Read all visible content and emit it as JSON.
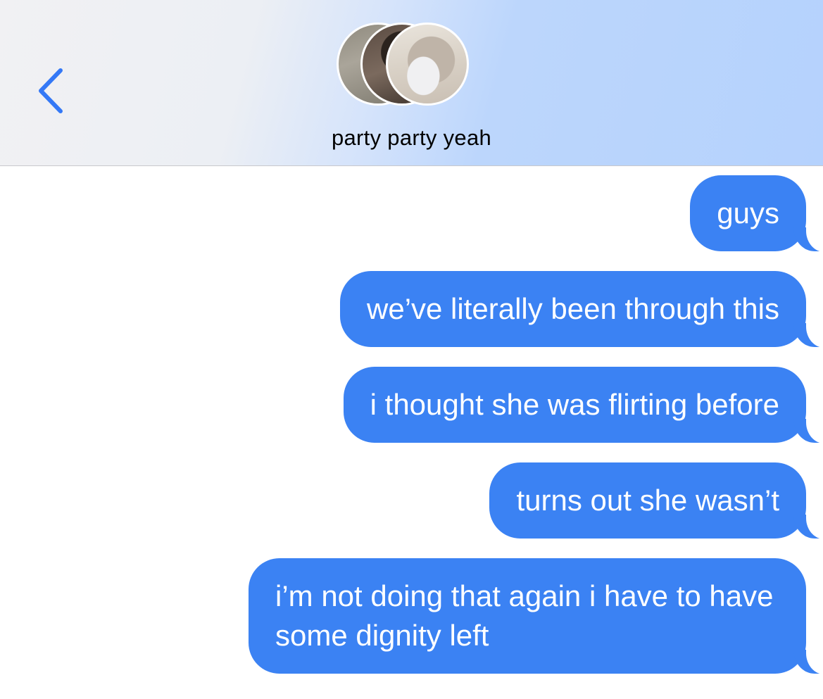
{
  "header": {
    "title": "party party yeah",
    "back_icon": "chevron-left-icon",
    "accent_color": "#3478f6"
  },
  "messages": [
    {
      "sender": "me",
      "text": "guys"
    },
    {
      "sender": "me",
      "text": "we’ve literally been through this"
    },
    {
      "sender": "me",
      "text": "i thought she was flirting before"
    },
    {
      "sender": "me",
      "text": "turns out she wasn’t"
    },
    {
      "sender": "me",
      "text": "i’m not doing that again i have to have some dignity left"
    }
  ],
  "colors": {
    "bubble": "#3b82f3",
    "bubble_text": "#ffffff",
    "background": "#ffffff"
  }
}
